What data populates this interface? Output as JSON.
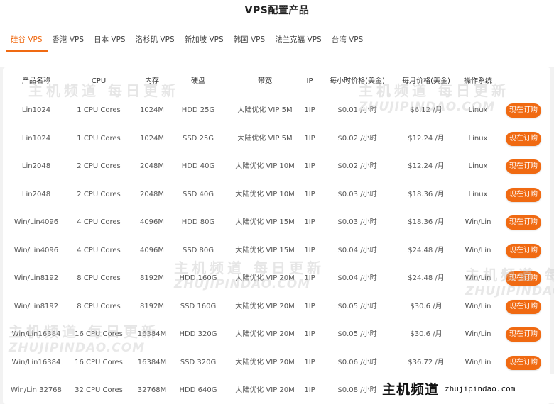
{
  "page": {
    "title": "VPS配置产品"
  },
  "tabs": [
    {
      "label": "硅谷 VPS",
      "active": true
    },
    {
      "label": "香港 VPS",
      "active": false
    },
    {
      "label": "日本 VPS",
      "active": false
    },
    {
      "label": "洛杉矶 VPS",
      "active": false
    },
    {
      "label": "新加坡 VPS",
      "active": false
    },
    {
      "label": "韩国 VPS",
      "active": false
    },
    {
      "label": "法兰克福 VPS",
      "active": false
    },
    {
      "label": "台湾 VPS",
      "active": false
    }
  ],
  "table": {
    "headers": [
      "产品名称",
      "CPU",
      "内存",
      "硬盘",
      "带宽",
      "IP",
      "每小时价格(美金)",
      "每月价格(美金)",
      "操作系统"
    ],
    "order_label": "现在订购",
    "rows": [
      {
        "name": "Lin1024",
        "cpu": "1 CPU Cores",
        "ram": "1024M",
        "disk": "HDD 25G",
        "bw": "大陆优化 VIP 5M",
        "ip": "1IP",
        "hourly": "$0.01 /小时",
        "monthly": "$6.12 /月",
        "os": "Linux"
      },
      {
        "name": "Lin1024",
        "cpu": "1 CPU Cores",
        "ram": "1024M",
        "disk": "SSD 25G",
        "bw": "大陆优化 VIP 5M",
        "ip": "1IP",
        "hourly": "$0.02 /小时",
        "monthly": "$12.24 /月",
        "os": "Linux"
      },
      {
        "name": "Lin2048",
        "cpu": "2 CPU Cores",
        "ram": "2048M",
        "disk": "HDD 40G",
        "bw": "大陆优化 VIP 10M",
        "ip": "1IP",
        "hourly": "$0.02 /小时",
        "monthly": "$12.24 /月",
        "os": "Linux"
      },
      {
        "name": "Lin2048",
        "cpu": "2 CPU Cores",
        "ram": "2048M",
        "disk": "SSD 40G",
        "bw": "大陆优化 VIP 10M",
        "ip": "1IP",
        "hourly": "$0.03 /小时",
        "monthly": "$18.36 /月",
        "os": "Linux"
      },
      {
        "name": "Win/Lin4096",
        "cpu": "4 CPU Cores",
        "ram": "4096M",
        "disk": "HDD 80G",
        "bw": "大陆优化 VIP 15M",
        "ip": "1IP",
        "hourly": "$0.03 /小时",
        "monthly": "$18.36 /月",
        "os": "Win/Lin"
      },
      {
        "name": "Win/Lin4096",
        "cpu": "4 CPU Cores",
        "ram": "4096M",
        "disk": "SSD 80G",
        "bw": "大陆优化 VIP 15M",
        "ip": "1IP",
        "hourly": "$0.04 /小时",
        "monthly": "$24.48 /月",
        "os": "Win/Lin"
      },
      {
        "name": "Win/Lin8192",
        "cpu": "8 CPU Cores",
        "ram": "8192M",
        "disk": "HDD 160G",
        "bw": "大陆优化 VIP 20M",
        "ip": "1IP",
        "hourly": "$0.04 /小时",
        "monthly": "$24.48 /月",
        "os": "Win/Lin"
      },
      {
        "name": "Win/Lin8192",
        "cpu": "8 CPU Cores",
        "ram": "8192M",
        "disk": "SSD 160G",
        "bw": "大陆优化 VIP 20M",
        "ip": "1IP",
        "hourly": "$0.05 /小时",
        "monthly": "$30.6 /月",
        "os": "Win/Lin"
      },
      {
        "name": "Win/Lin16384",
        "cpu": "16 CPU Cores",
        "ram": "16384M",
        "disk": "HDD 320G",
        "bw": "大陆优化 VIP 20M",
        "ip": "1IP",
        "hourly": "$0.05 /小时",
        "monthly": "$30.6 /月",
        "os": "Win/Lin"
      },
      {
        "name": "Win/Lin16384",
        "cpu": "16 CPU Cores",
        "ram": "16384M",
        "disk": "SSD 320G",
        "bw": "大陆优化 VIP 20M",
        "ip": "1IP",
        "hourly": "$0.06 /小时",
        "monthly": "$36.72 /月",
        "os": "Win/Lin"
      },
      {
        "name": "Win/Lin 32768",
        "cpu": "32 CPU Cores",
        "ram": "32768M",
        "disk": "HDD 640G",
        "bw": "大陆优化 VIP 20M",
        "ip": "1IP",
        "hourly": "$0.08 /小时",
        "monthly": "",
        "os": ""
      }
    ]
  },
  "watermark": {
    "cn": "主机频道 每日更新",
    "en": "ZHUJIPINDAO.COM"
  },
  "brand": {
    "cn": "主机频道",
    "en": "zhujipindao.com"
  },
  "colors": {
    "accent": "#f06a12"
  }
}
